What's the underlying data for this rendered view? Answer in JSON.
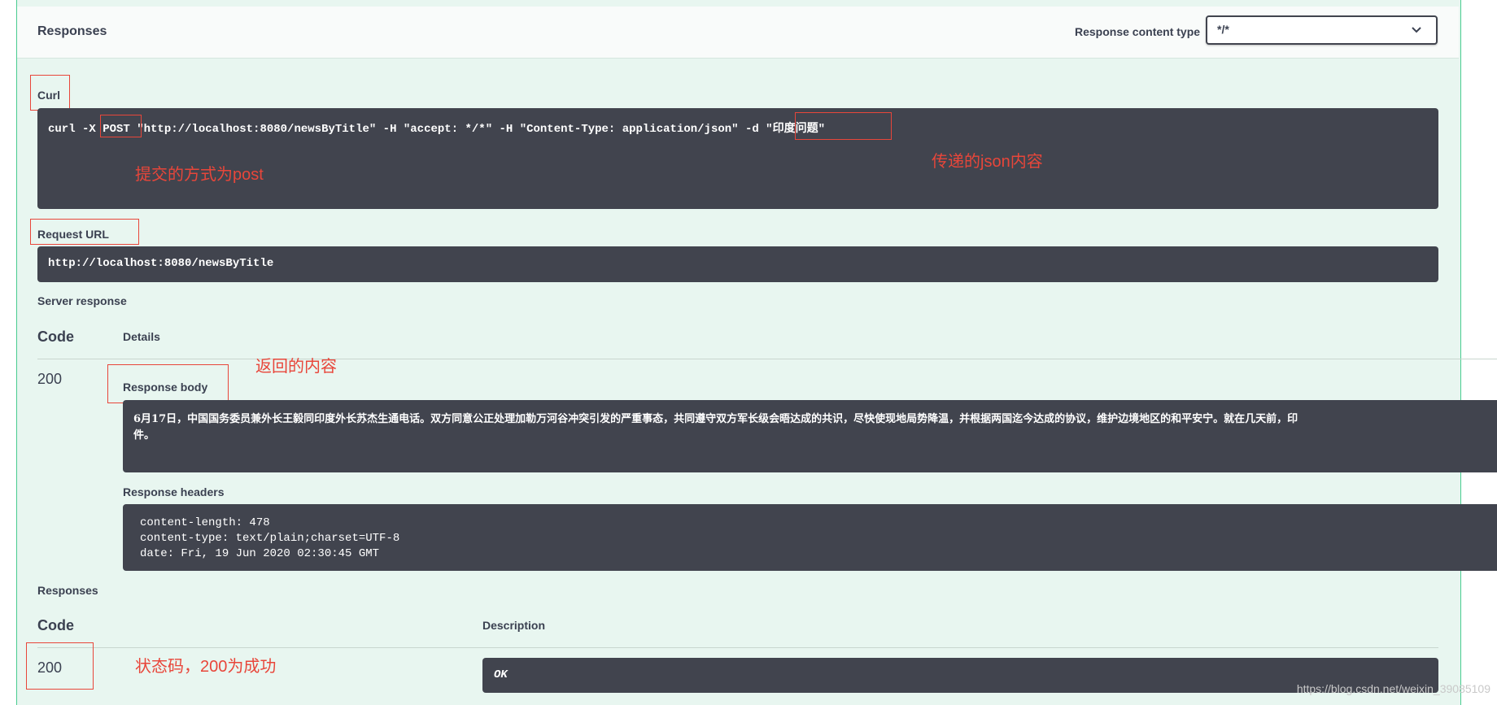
{
  "header": {
    "title": "Responses",
    "content_type_label": "Response content type",
    "content_type_value": "*/*"
  },
  "curl": {
    "label": "Curl",
    "prefix": "curl -X ",
    "method": "POST",
    "middle": " \"http://localhost:8080/newsByTitle\" -H \"accept: */*\" -H \"Content-Type: application/json\" ",
    "data_flag": "-d",
    "data_value": "\"印度问题\""
  },
  "request_url": {
    "label": "Request URL",
    "value": "http://localhost:8080/newsByTitle"
  },
  "server_response": {
    "label": "Server response",
    "code_header": "Code",
    "details_header": "Details",
    "code": "200",
    "body_label": "Response body",
    "body_line1": "6月17日，中国国务委员兼外长王毅同印度外长苏杰生通电话。双方同意公正处理加勒万河谷冲突引发的严重事态，共同遵守双方军长级会晤达成的共识，尽快使现地局势降温，并根据两国迄今达成的协议，维护边境地区的和平安宁。就在几天前，印",
    "body_line2": "件。",
    "headers_label": "Response headers",
    "headers": [
      "content-length: 478",
      "content-type: text/plain;charset=UTF-8",
      "date: Fri, 19 Jun 2020 02:30:45 GMT"
    ]
  },
  "responses": {
    "label": "Responses",
    "code_header": "Code",
    "description_header": "Description",
    "code": "200",
    "description": "OK"
  },
  "annotations": {
    "post_note": "提交的方式为post",
    "json_note": "传递的json内容",
    "return_note": "返回的内容",
    "status_note": "状态码，200为成功"
  },
  "watermark": "https://blog.csdn.net/weixin_39085109",
  "colors": {
    "panel_bg": "#e8f6f0",
    "border_green": "#49cc90",
    "code_bg": "#41444e",
    "annotation_red": "#e8463a"
  }
}
